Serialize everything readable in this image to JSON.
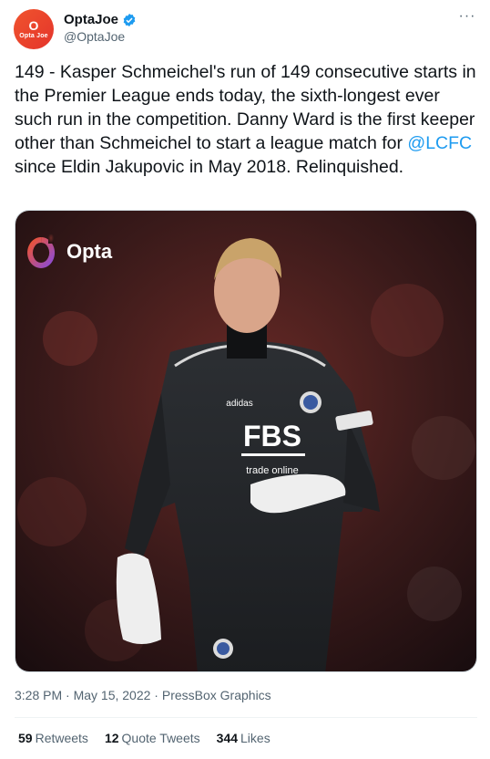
{
  "account": {
    "display_name": "OptaJoe",
    "handle": "@OptaJoe",
    "avatar_text": "Opta",
    "avatar_subtext": "Opta Joe"
  },
  "tweet": {
    "text_before": "149 - Kasper Schmeichel's run of 149 consecutive starts in the Premier League ends today, the sixth-longest ever such run in the competition. Danny Ward is the first keeper other than Schmeichel to start a league match for ",
    "mention": "@LCFC",
    "text_after": " since Eldin Jakupovic in May 2018. Relinquished.",
    "time": "3:28 PM · May 15, 2022 · PressBox Graphics"
  },
  "media": {
    "brand_label": "Opta",
    "shirt_sponsor": "FBS",
    "shirt_sponsor_sub": "trade online",
    "kit_brand": "adidas"
  },
  "stats": {
    "retweets_count": "59",
    "retweets_label": "Retweets",
    "quotes_count": "12",
    "quotes_label": "Quote Tweets",
    "likes_count": "344",
    "likes_label": "Likes"
  },
  "icons": {
    "verified": "verified-badge-icon",
    "more": "more-options-icon"
  },
  "colors": {
    "accent": "#1d9bf0",
    "brand": "#e8432d"
  }
}
